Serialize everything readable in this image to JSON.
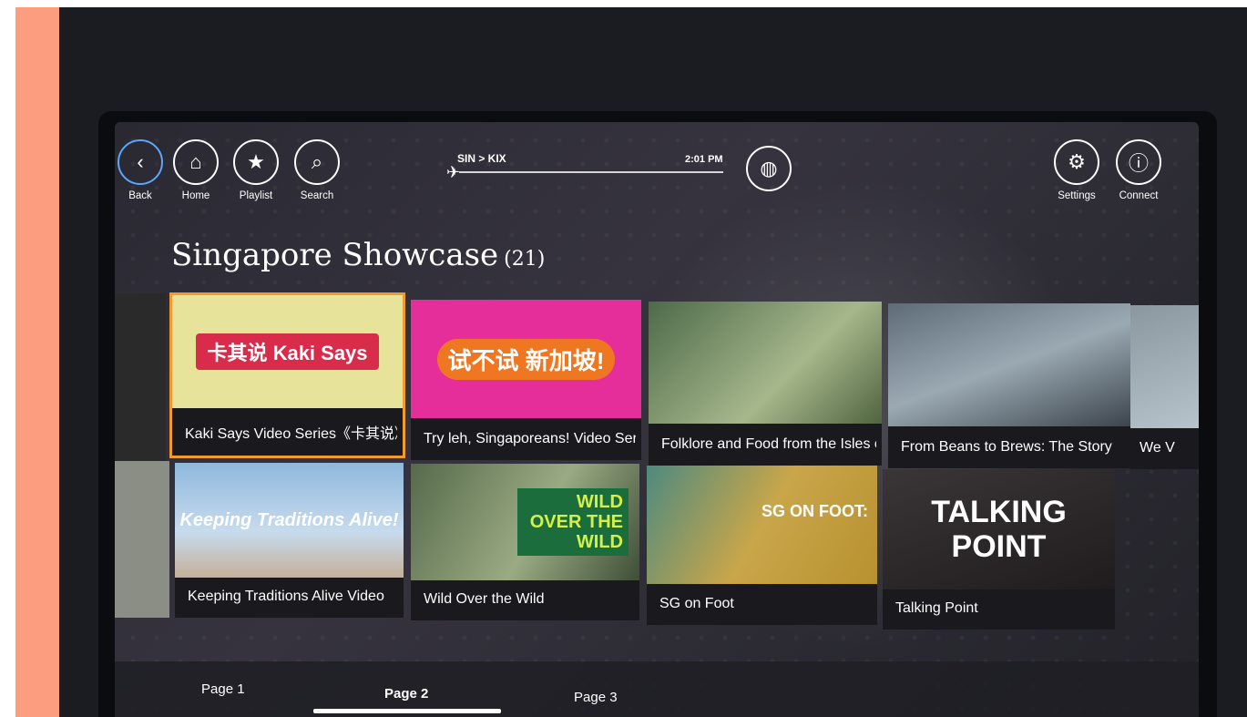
{
  "nav": {
    "back_label": "Back",
    "home_label": "Home",
    "playlist_label": "Playlist",
    "search_label": "Search",
    "settings_label": "Settings",
    "connect_label": "Connect"
  },
  "flight": {
    "route": "SIN > KIX",
    "time": "2:01 PM"
  },
  "section": {
    "title": "Singapore Showcase",
    "count": "(21)"
  },
  "cards": [
    {
      "title": "Kaki Says Video Series《卡其说》",
      "thumb_text": "卡其说 Kaki Says",
      "color": "#e7e39a"
    },
    {
      "title": "Try leh, Singaporeans! Video Series",
      "thumb_text": "试不试 新加坡!",
      "color": "#e62e9a"
    },
    {
      "title": "Folklore and Food from the Isles of Singapore",
      "thumb_text": "",
      "color": "#5f7a56"
    },
    {
      "title": "From Beans to Brews: The Story",
      "thumb_text": "",
      "color": "#6b7a85"
    },
    {
      "title": "We V",
      "thumb_text": "",
      "color": "#7f8c95"
    },
    {
      "title": "Keeping Traditions Alive Video",
      "thumb_text": "Keeping Traditions Alive!",
      "color": "#8fb8dd"
    },
    {
      "title": "Wild Over the Wild",
      "thumb_text": "WILD OVER THE WILD",
      "color": "#6e7d59"
    },
    {
      "title": "SG on Foot",
      "thumb_text": "SG ON FOOT:",
      "color": "#b69a3c"
    },
    {
      "title": "Talking Point",
      "thumb_text": "TALKING POINT",
      "color": "#2d2a2e"
    }
  ],
  "pagination": {
    "page1": "Page 1",
    "page2": "Page 2",
    "page3": "Page 3"
  },
  "colors": {
    "highlight": "#f29a2e",
    "accent_left": "#fc9d80"
  }
}
